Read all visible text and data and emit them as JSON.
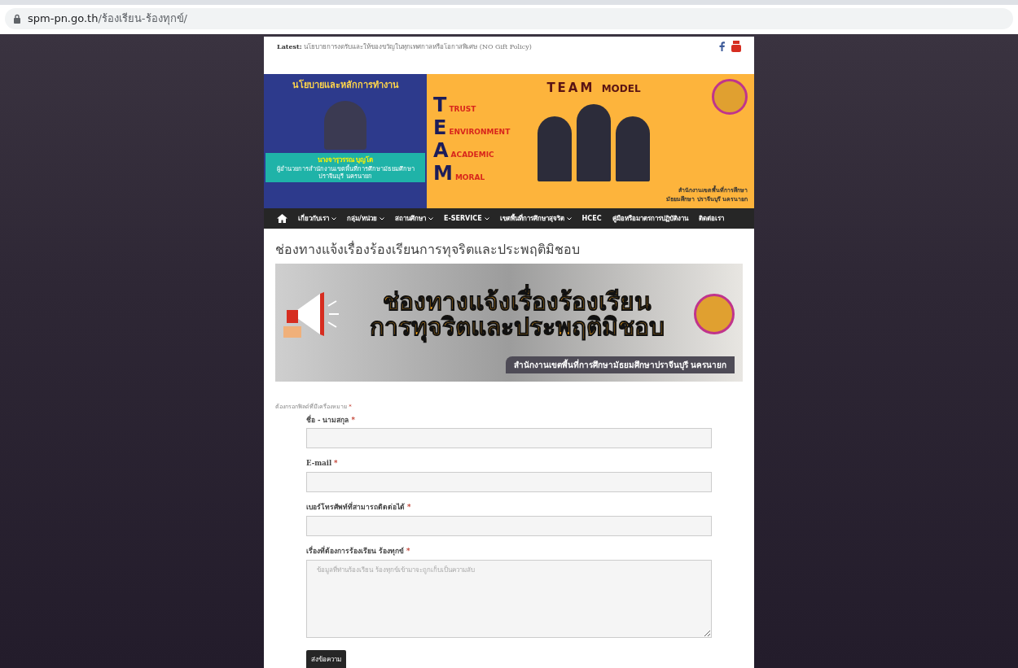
{
  "browser": {
    "url_host": "spm-pn.go.th",
    "url_path": "/ร้องเรียน-ร้องทุกข์/"
  },
  "top_bar": {
    "latest_label": "Latest:",
    "latest_text": "นโยบายการงดรับและให้ของขวัญในทุกเทศกาลหรือโอกาสพิเศษ (NO Gift Policy)"
  },
  "header_banner": {
    "heading": "นโยบายและหลักการทำงาน",
    "person_name": "นางจารุวรรณ บุญโต",
    "person_role": "ผู้อำนวยการสำนักงานเขตพื้นที่การศึกษามัธยมศึกษาปราจีนบุรี นครนายก",
    "model_title": "TEAM",
    "model_suffix": "MODEL",
    "values": [
      {
        "letter": "T",
        "word": "TRUST"
      },
      {
        "letter": "E",
        "word": "ENVIRONMENT"
      },
      {
        "letter": "A",
        "word": "ACADEMIC"
      },
      {
        "letter": "M",
        "word": "MORAL"
      }
    ],
    "office": "สำนักงานเขตพื้นที่การศึกษามัธยมศึกษา ปราจีนบุรี นครนายก"
  },
  "nav": [
    {
      "label": "เกี่ยวกับเรา",
      "has_menu": true
    },
    {
      "label": "กลุ่ม/หน่วย",
      "has_menu": true
    },
    {
      "label": "สถานศึกษา",
      "has_menu": true
    },
    {
      "label": "E-SERVICE",
      "has_menu": true
    },
    {
      "label": "เขตพื้นที่การศึกษาสุจริต",
      "has_menu": true
    },
    {
      "label": "HCEC",
      "has_menu": false
    },
    {
      "label": "คู่มือหรือมาตรการปฏิบัติงาน",
      "has_menu": false
    },
    {
      "label": "ติดต่อเรา",
      "has_menu": false
    }
  ],
  "page_title": "ช่องทางแจ้งเรื่องร้องเรียนการทุจริตและประพฤติมิชอบ",
  "complaint_banner": {
    "headline_1": "ช่องทางแจ้งเรื่องร้องเรียน",
    "headline_2": "การทุจริตและประพฤติมิชอบ",
    "office": "สำนักงานเขตพื้นที่การศึกษามัธยมศึกษาปราจีนบุรี นครนายก"
  },
  "form": {
    "required_note": "ต้องกรอกฟิลด์ที่มีเครื่องหมาย",
    "required_mark": "*",
    "fields": [
      {
        "kind": "input",
        "label": "ชื่อ - นามสกุล",
        "required": true
      },
      {
        "kind": "input",
        "label": "E-mail",
        "required": true
      },
      {
        "kind": "input",
        "label": "เบอร์โทรศัพท์ที่สามารถติดต่อได้",
        "required": true
      },
      {
        "kind": "textarea",
        "label": "เรื่องที่ต้องการร้องเรียน ร้องทุกข์",
        "required": true,
        "placeholder": "ข้อมูลที่ท่านร้องเรียน ร้องทุกข์เข้ามาจะถูกเก็บเป็นความลับ"
      }
    ],
    "submit": "ส่งข้อความ"
  }
}
